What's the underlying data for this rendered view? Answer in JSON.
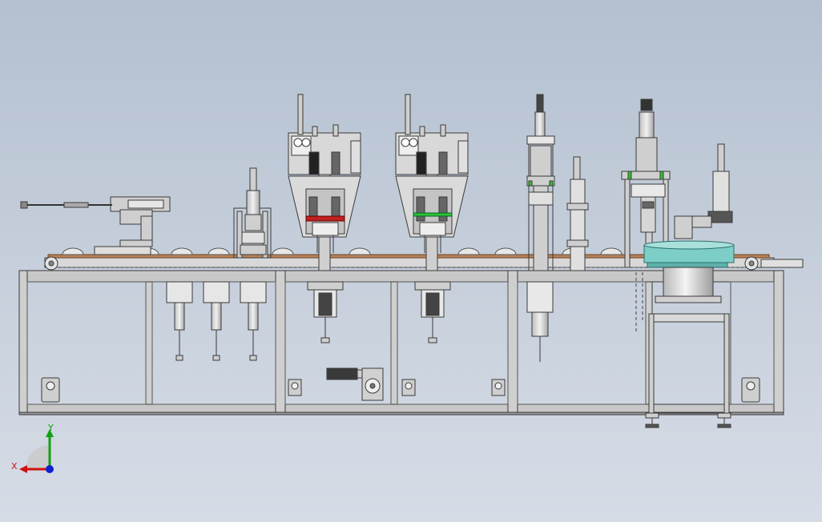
{
  "viewport": {
    "triad": {
      "x_label": "X",
      "y_label": "Y",
      "x_color": "#d01010",
      "y_color": "#10a010",
      "z_color": "#1020d0"
    }
  },
  "colors": {
    "frame_fill": "#c8c8c8",
    "frame_stroke": "#3a3a3a",
    "conveyor": "#b8825a",
    "hopper": "#7ecec8",
    "accent_red": "#c02020",
    "accent_green": "#30c030"
  }
}
